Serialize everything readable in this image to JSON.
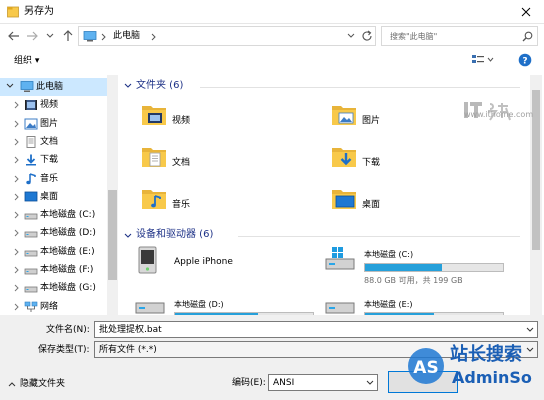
{
  "window": {
    "title": "另存为"
  },
  "address": {
    "breadcrumb": "此电脑",
    "search_placeholder": "搜索\"此电脑\""
  },
  "toolbar": {
    "organize": "组织 ▾"
  },
  "nav": {
    "items": [
      {
        "label": "此电脑",
        "icon": "pc-icon",
        "selected": true,
        "expanded": true
      },
      {
        "label": "视频",
        "icon": "video-folder-icon"
      },
      {
        "label": "图片",
        "icon": "pictures-folder-icon"
      },
      {
        "label": "文档",
        "icon": "documents-folder-icon"
      },
      {
        "label": "下载",
        "icon": "download-icon"
      },
      {
        "label": "音乐",
        "icon": "music-icon"
      },
      {
        "label": "桌面",
        "icon": "desktop-folder-icon"
      },
      {
        "label": "本地磁盘 (C:)",
        "icon": "drive-icon"
      },
      {
        "label": "本地磁盘 (D:)",
        "icon": "drive-icon"
      },
      {
        "label": "本地磁盘 (E:)",
        "icon": "drive-icon"
      },
      {
        "label": "本地磁盘 (F:)",
        "icon": "drive-icon"
      },
      {
        "label": "本地磁盘 (G:)",
        "icon": "drive-icon"
      },
      {
        "label": "网络",
        "icon": "network-icon"
      }
    ]
  },
  "content": {
    "folders_header": "文件夹 (6)",
    "folders": [
      {
        "label": "视频",
        "icon": "video-folder-icon"
      },
      {
        "label": "图片",
        "icon": "pictures-folder-icon"
      },
      {
        "label": "文档",
        "icon": "documents-folder-icon"
      },
      {
        "label": "下载",
        "icon": "downloads-folder-icon"
      },
      {
        "label": "音乐",
        "icon": "music-folder-icon"
      },
      {
        "label": "桌面",
        "icon": "desktop-folder-icon"
      }
    ],
    "devices_header": "设备和驱动器 (6)",
    "devices": [
      {
        "label": "Apple iPhone",
        "icon": "phone-device-icon"
      },
      {
        "label": "本地磁盘 (C:)",
        "icon": "system-drive-icon",
        "free": "88.0 GB 可用，共 199 GB",
        "used_fraction": 0.56
      },
      {
        "label": "本地磁盘 (D:)",
        "icon": "drive-icon",
        "used_fraction": 0.6
      },
      {
        "label": "本地磁盘 (E:)",
        "icon": "drive-icon",
        "used_fraction": 0.5
      }
    ]
  },
  "footer": {
    "filename_label": "文件名(N):",
    "filename_value": "批处理提权.bat",
    "filetype_label": "保存类型(T):",
    "filetype_value": "所有文件 (*.*)",
    "hide_folders": "隐藏文件夹",
    "encoding_label": "编码(E):",
    "encoding_value": "ANSI"
  },
  "watermarks": {
    "ithome_url": "www.ithome.com",
    "admin_text1": "站长搜索",
    "admin_text2": "AdminSo"
  },
  "colors": {
    "accent": "#0078d7",
    "selection": "#cce8ff",
    "drive_bar": "#26a0da",
    "folder": "#f8c94a"
  }
}
